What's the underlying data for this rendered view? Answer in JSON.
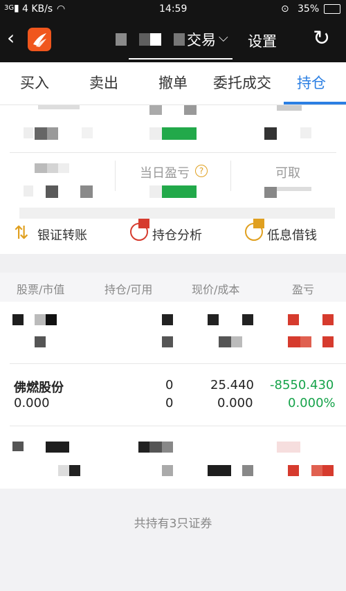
{
  "status_bar": {
    "signal": "3G",
    "speed": "4 KB/s",
    "time": "14:59",
    "battery": "35%"
  },
  "header": {
    "title_suffix": "交易",
    "settings": "设置"
  },
  "tabs": [
    {
      "label": "买入"
    },
    {
      "label": "卖出"
    },
    {
      "label": "撤单"
    },
    {
      "label": "委托成交"
    },
    {
      "label": "持仓"
    }
  ],
  "summary": {
    "daily_pnl_label": "当日盈亏",
    "withdrawable_label": "可取"
  },
  "actions": [
    {
      "label": "银证转账"
    },
    {
      "label": "持仓分析"
    },
    {
      "label": "低息借钱"
    }
  ],
  "table": {
    "headers": [
      "股票/市值",
      "持仓/可用",
      "现价/成本",
      "盈亏"
    ],
    "visible_row": {
      "name": "佛燃股份",
      "market_value": "0.000",
      "holding": "0",
      "available": "0",
      "price": "25.440",
      "cost": "0.000",
      "pnl": "-8550.430",
      "pnl_pct": "0.000%"
    }
  },
  "footer": {
    "text": "共持有3只证券"
  },
  "colors": {
    "accent": "#2b7fe3",
    "loss": "#16a34a",
    "red": "#d63b2e"
  }
}
